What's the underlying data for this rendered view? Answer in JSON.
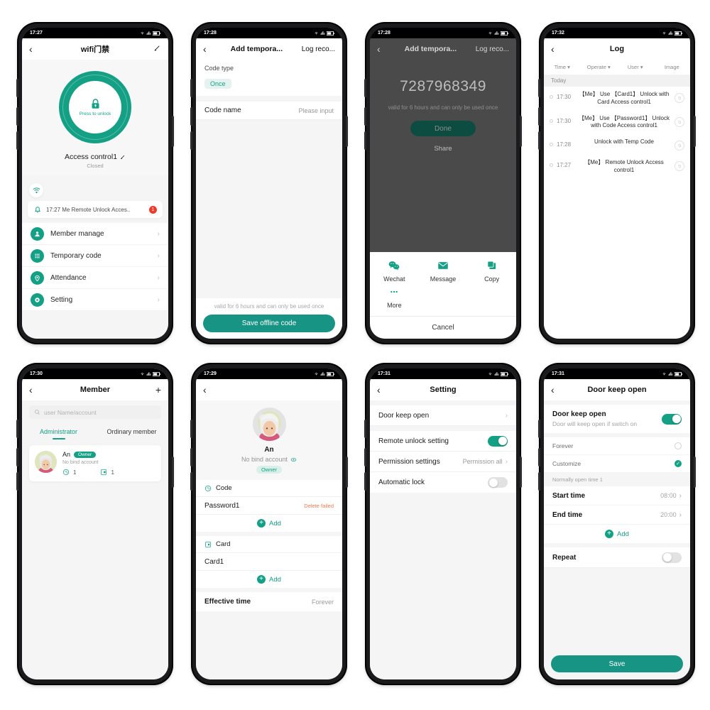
{
  "phones": [
    {
      "id": "device-home",
      "status": {
        "time": "17:27"
      },
      "nav": {
        "title": "wifi门禁",
        "back": "‹",
        "edit_icon": "pencil-icon"
      },
      "unlock": {
        "label": "Press to unlock",
        "device_name": "Access control1",
        "state": "Closed"
      },
      "notice": {
        "text": "17:27 Me  Remote Unlock Acces..",
        "badge": "1"
      },
      "menu": [
        {
          "label": "Member manage",
          "icon": "person-icon"
        },
        {
          "label": "Temporary code",
          "icon": "keypad-icon"
        },
        {
          "label": "Attendance",
          "icon": "location-icon"
        },
        {
          "label": "Setting",
          "icon": "gear-icon"
        }
      ]
    },
    {
      "id": "device-add-temp-code",
      "status": {
        "time": "17:28"
      },
      "nav": {
        "title": "Add tempora...",
        "right_link": "Log reco..."
      },
      "code_type": {
        "label": "Code type",
        "value": "Once"
      },
      "code_name": {
        "label": "Code name",
        "placeholder": "Please input"
      },
      "footer_hint": "valid for 6 hours and can only be used once",
      "save_button": "Save offline code"
    },
    {
      "id": "device-share-code",
      "status": {
        "time": "17:28"
      },
      "nav": {
        "title": "Add tempora...",
        "right_link": "Log reco..."
      },
      "code": "7287968349",
      "hint": "valid for 6 hours and can only be used once",
      "done_button": "Done",
      "share_link": "Share",
      "share_items": [
        {
          "label": "Wechat",
          "icon": "wechat-icon"
        },
        {
          "label": "Message",
          "icon": "envelope-icon"
        },
        {
          "label": "Copy",
          "icon": "copy-icon"
        },
        {
          "label": "More",
          "icon": "ellipsis-icon"
        }
      ],
      "cancel": "Cancel"
    },
    {
      "id": "device-log",
      "status": {
        "time": "17:32"
      },
      "nav": {
        "title": "Log"
      },
      "columns": [
        "Time",
        "Operate",
        "User",
        "Image"
      ],
      "day_group": "Today",
      "entries": [
        {
          "time": "17:30",
          "text": "【Me】 Use 【Card1】 Unlock with Card Access control1"
        },
        {
          "time": "17:30",
          "text": "【Me】 Use 【Password1】 Unlock with Code Access control1"
        },
        {
          "time": "17:28",
          "text": "Unlock with Temp Code"
        },
        {
          "time": "17:27",
          "text": "【Me】 Remote Unlock Access control1"
        }
      ]
    },
    {
      "id": "device-member-list",
      "status": {
        "time": "17:30"
      },
      "nav": {
        "title": "Member",
        "add_icon": "plus-icon"
      },
      "search_placeholder": "user Name/account",
      "tabs": [
        {
          "label": "Administrator",
          "active": true
        },
        {
          "label": "Ordinary member",
          "active": false
        }
      ],
      "member": {
        "name": "An",
        "tag": "Owner",
        "bind": "No bind account",
        "counts": [
          {
            "icon": "fingerprint-icon",
            "value": "1"
          },
          {
            "icon": "card-icon",
            "value": "1"
          }
        ]
      }
    },
    {
      "id": "device-member-detail",
      "status": {
        "time": "17:29"
      },
      "nav": {
        "title": ""
      },
      "profile": {
        "name": "An",
        "bind": "No bind account",
        "tag": "Owner",
        "eye_icon": "eye-icon"
      },
      "code_section": {
        "title": "Code",
        "icon": "fingerprint-icon",
        "item": "Password1",
        "status": "Delete failed",
        "add": "Add"
      },
      "card_section": {
        "title": "Card",
        "icon": "card-icon",
        "item": "Card1",
        "add": "Add"
      },
      "effective_time": {
        "label": "Effective time",
        "value": "Forever"
      }
    },
    {
      "id": "device-setting",
      "status": {
        "time": "17:31"
      },
      "nav": {
        "title": "Setting"
      },
      "rows": [
        {
          "label": "Door keep open",
          "type": "chevron",
          "value": ""
        },
        {
          "label": "Remote unlock setting",
          "type": "toggle",
          "on": true
        },
        {
          "label": "Permission settings",
          "type": "chevron",
          "value": "Permission all"
        },
        {
          "label": "Automatic lock",
          "type": "toggle",
          "on": false
        }
      ]
    },
    {
      "id": "device-door-keep-open",
      "status": {
        "time": "17:31"
      },
      "nav": {
        "title": "Door keep open"
      },
      "main_toggle": {
        "title": "Door keep open",
        "subtitle": "Door will keep open if switch on",
        "on": true
      },
      "options": [
        {
          "label": "Forever",
          "selected": false
        },
        {
          "label": "Customize",
          "selected": true
        }
      ],
      "subhead": "Normally open time 1",
      "times": [
        {
          "label": "Start time",
          "value": "08:00"
        },
        {
          "label": "End time",
          "value": "20:00"
        }
      ],
      "add": "Add",
      "repeat": {
        "label": "Repeat",
        "on": false
      },
      "save_button": "Save"
    }
  ],
  "theme": {
    "accent": "#14A085",
    "accent_dark": "#189484",
    "danger": "#ef3b2d",
    "warn": "#f2784b"
  }
}
